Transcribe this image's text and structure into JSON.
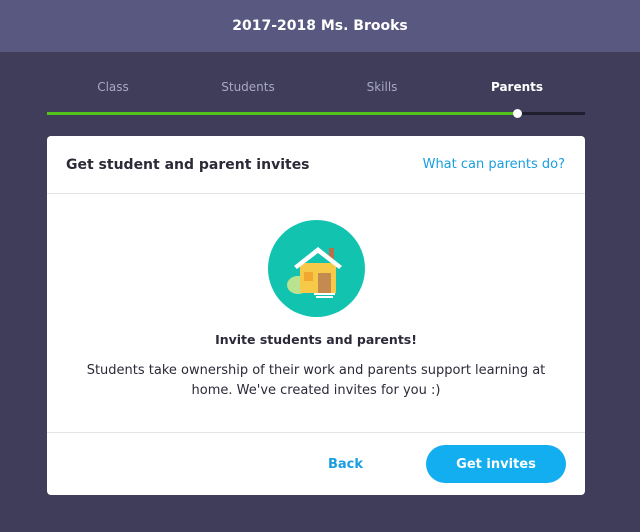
{
  "header": {
    "title": "2017-2018 Ms. Brooks"
  },
  "steps": {
    "items": [
      {
        "label": "Class"
      },
      {
        "label": "Students"
      },
      {
        "label": "Skills"
      },
      {
        "label": "Parents"
      }
    ],
    "active_index": 3,
    "progress_fraction": 0.875
  },
  "card": {
    "title": "Get student and parent invites",
    "help_link": "What can parents do?",
    "illustration": "house-icon",
    "heading": "Invite students and parents!",
    "description": "Students take ownership of their work and parents support learning at home. We've created invites for you :)",
    "back_label": "Back",
    "primary_label": "Get invites"
  },
  "colors": {
    "background": "#3f3d5a",
    "topbar": "#585880",
    "progress": "#52c41a",
    "accent": "#12aef0",
    "illustration_circle": "#12c4b0"
  }
}
